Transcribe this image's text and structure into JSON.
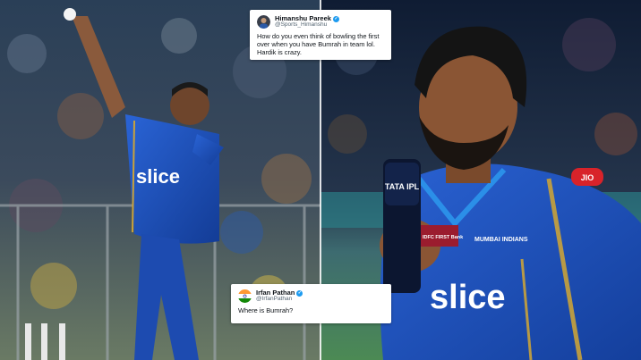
{
  "tweets": [
    {
      "name": "Himanshu Pareek",
      "handle": "@Sports_Himanshu",
      "text": "How do you even think of bowling the first over when you have Bumrah in team lol. Hardik is crazy.",
      "verified": true
    },
    {
      "name": "Irfan Pathan",
      "handle": "@IrfanPathan",
      "text": "Where is Bumrah?",
      "verified": true
    }
  ],
  "photo_left": {
    "jersey_text": "slice"
  },
  "photo_right": {
    "jersey_text": "slice",
    "mic_brand": "TATA IPL",
    "sponsor_text": "IDFC FIRST Bank",
    "team_badge": "MUMBAI INDIANS",
    "sleeve_text": "JIO"
  },
  "colors": {
    "mi_blue": "#1c4fb5",
    "mi_gold": "#c9a23a",
    "twitter_blue": "#1d9bf0"
  }
}
